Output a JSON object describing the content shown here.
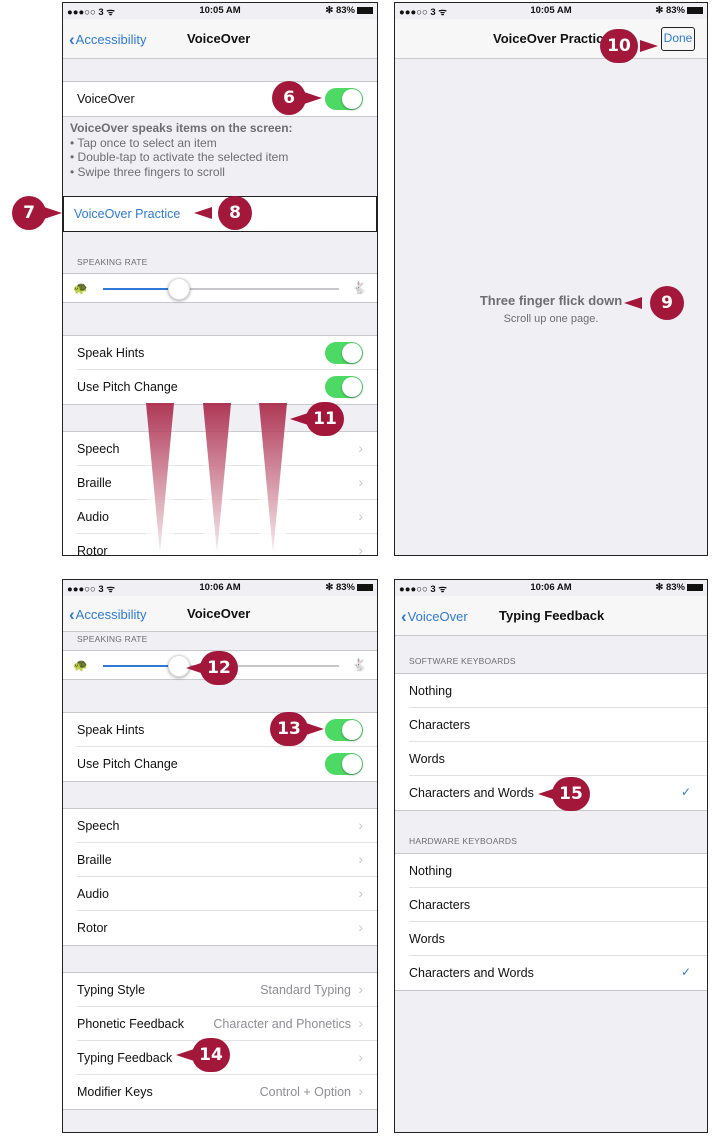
{
  "panel1": {
    "status": {
      "signal": "●●●○○ 3 ᯤ",
      "time": "10:05 AM",
      "battery": "✻ 83%"
    },
    "back_label": "Accessibility",
    "title": "VoiceOver",
    "voiceover_label": "VoiceOver",
    "voiceover_on": true,
    "desc_heading": "VoiceOver speaks items on the screen:",
    "desc_lines": [
      "• Tap once to select an item",
      "• Double-tap to activate the selected item",
      "• Swipe three fingers to scroll"
    ],
    "practice_label": "VoiceOver Practice",
    "speaking_rate_header": "SPEAKING RATE",
    "speaking_rate_value": 0.22,
    "speak_hints_label": "Speak Hints",
    "use_pitch_label": "Use Pitch Change",
    "nav_rows": [
      "Speech",
      "Braille",
      "Audio",
      "Rotor"
    ]
  },
  "panel2": {
    "status": {
      "signal": "●●●○○ 3 ᯤ",
      "time": "10:05 AM",
      "battery": "✻ 83%"
    },
    "title": "VoiceOver Practice",
    "done_label": "Done",
    "gesture_name": "Three finger flick down",
    "gesture_desc": "Scroll up one page."
  },
  "panel3": {
    "status": {
      "signal": "●●●○○ 3 ᯤ",
      "time": "10:06 AM",
      "battery": "✻ 83%"
    },
    "back_label": "Accessibility",
    "title": "VoiceOver",
    "speaking_rate_header": "SPEAKING RATE",
    "speaking_rate_value": 0.22,
    "speak_hints_label": "Speak Hints",
    "use_pitch_label": "Use Pitch Change",
    "nav_rows": [
      "Speech",
      "Braille",
      "Audio",
      "Rotor"
    ],
    "typing_style_label": "Typing Style",
    "typing_style_value": "Standard Typing",
    "phonetic_label": "Phonetic Feedback",
    "phonetic_value": "Character and Phonetics",
    "typing_feedback_label": "Typing Feedback",
    "modifier_label": "Modifier Keys",
    "modifier_value": "Control + Option"
  },
  "panel4": {
    "status": {
      "signal": "●●●○○ 3 ᯤ",
      "time": "10:06 AM",
      "battery": "✻ 83%"
    },
    "back_label": "VoiceOver",
    "title": "Typing Feedback",
    "software_header": "SOFTWARE KEYBOARDS",
    "software_options": [
      "Nothing",
      "Characters",
      "Words",
      "Characters and Words"
    ],
    "hardware_header": "HARDWARE KEYBOARDS",
    "hardware_options": [
      "Nothing",
      "Characters",
      "Words",
      "Characters and Words"
    ],
    "check_mark": "✓"
  },
  "callouts": {
    "c6": "6",
    "c7": "7",
    "c8": "8",
    "c9": "9",
    "c10": "10",
    "c11": "11",
    "c12": "12",
    "c13": "13",
    "c14": "14",
    "c15": "15"
  },
  "colors": {
    "accent": "#2f7ad6",
    "toggle_on": "#4cd964",
    "callout": "#a3173a",
    "group_bg": "#efeff4"
  }
}
